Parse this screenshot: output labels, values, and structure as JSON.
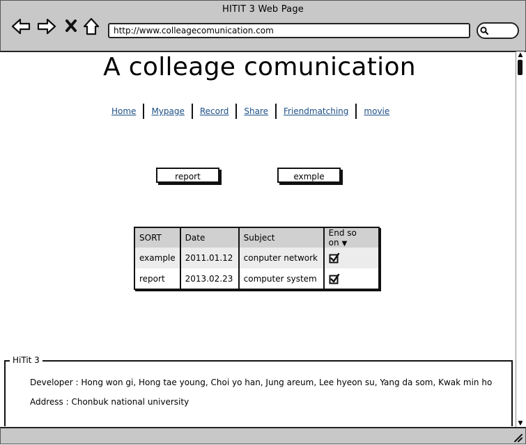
{
  "window": {
    "title": "HITIT 3 Web Page"
  },
  "toolbar": {
    "back_icon": "back-arrow-icon",
    "forward_icon": "forward-arrow-icon",
    "stop_icon": "close-icon",
    "home_icon": "home-icon",
    "url": "http://www.colleagecomunication.com",
    "search_icon": "search-icon"
  },
  "page": {
    "title": "A colleage comunication",
    "nav": [
      {
        "label": "Home"
      },
      {
        "label": "Mypage"
      },
      {
        "label": "Record"
      },
      {
        "label": "Share"
      },
      {
        "label": "Friendmatching"
      },
      {
        "label": "movie"
      }
    ],
    "buttons": {
      "report": "report",
      "example": "exmple"
    }
  },
  "table": {
    "headers": [
      "SORT",
      "Date",
      "Subject",
      "End so on"
    ],
    "rows": [
      {
        "sort": "example",
        "date": "2011.01.12",
        "subject": "conputer network",
        "done": true
      },
      {
        "sort": "report",
        "date": "2013.02.23",
        "subject": "computer system",
        "done": true
      }
    ]
  },
  "footer": {
    "legend": "HiTit 3",
    "developer": "Developer : Hong won gi, Hong tae young, Choi yo han, Jung areum,  Lee hyeon su, Yang da som, Kwak min ho",
    "address": "Address : Chonbuk national university"
  }
}
